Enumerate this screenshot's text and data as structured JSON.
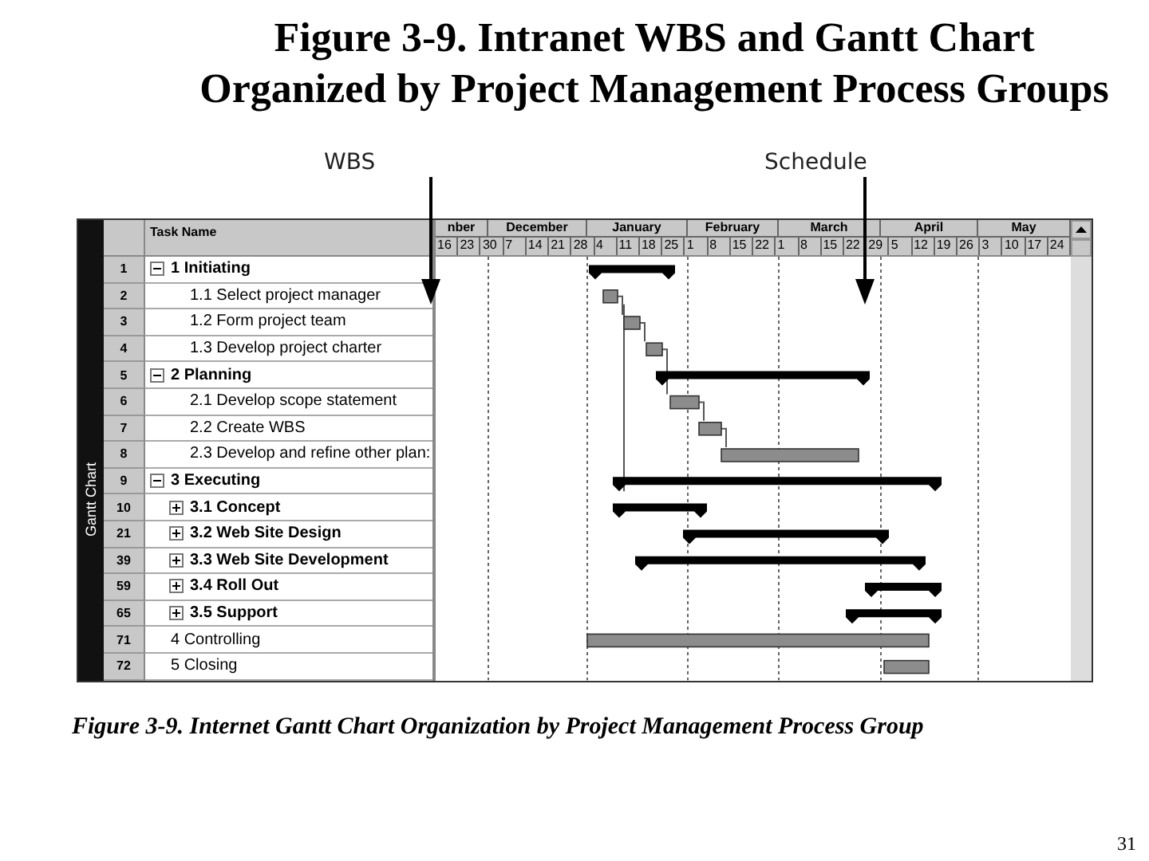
{
  "title": [
    "Figure 3-9.  Intranet WBS and Gantt Chart",
    "Organized by Project Management Process Groups"
  ],
  "callouts": [
    {
      "label": "WBS"
    },
    {
      "label": "Schedule"
    }
  ],
  "view_label": "Gantt Chart",
  "table": {
    "column": "Task Name",
    "months": [
      "nber",
      "December",
      "January",
      "February",
      "March",
      "April",
      "May"
    ],
    "weeks": [
      "16",
      "23",
      "30",
      "7",
      "14",
      "21",
      "28",
      "4",
      "11",
      "18",
      "25",
      "1",
      "8",
      "15",
      "22",
      "1",
      "8",
      "15",
      "22",
      "29",
      "5",
      "12",
      "19",
      "26",
      "3",
      "10",
      "17",
      "24"
    ],
    "tasks": [
      {
        "id": "1",
        "name": "1 Initiating",
        "expanded": true,
        "children": [
          {
            "id": "2",
            "name": "1.1 Select project manager"
          },
          {
            "id": "3",
            "name": "1.2 Form project team"
          },
          {
            "id": "4",
            "name": "1.3 Develop project charter"
          }
        ]
      },
      {
        "id": "5",
        "name": "2 Planning",
        "expanded": true,
        "children": [
          {
            "id": "6",
            "name": "2.1 Develop scope statement"
          },
          {
            "id": "7",
            "name": "2.2 Create WBS"
          },
          {
            "id": "8",
            "name": "2.3 Develop and refine other plan:"
          }
        ]
      },
      {
        "id": "9",
        "name": "3 Executing",
        "expanded": true,
        "children": [
          {
            "id": "10",
            "name": "3.1 Concept",
            "expanded": false
          },
          {
            "id": "21",
            "name": "3.2 Web Site Design",
            "expanded": false
          },
          {
            "id": "39",
            "name": "3.3 Web Site Development",
            "expanded": false
          },
          {
            "id": "59",
            "name": "3.4 Roll Out",
            "expanded": false
          },
          {
            "id": "65",
            "name": "3.5 Support",
            "expanded": false
          }
        ]
      },
      {
        "id": "71",
        "name": "4 Controlling"
      },
      {
        "id": "72",
        "name": "5 Closing"
      }
    ]
  },
  "caption": "Figure 3-9. Internet Gantt Chart Organization by Project Management Process Group",
  "page_number": "31"
}
